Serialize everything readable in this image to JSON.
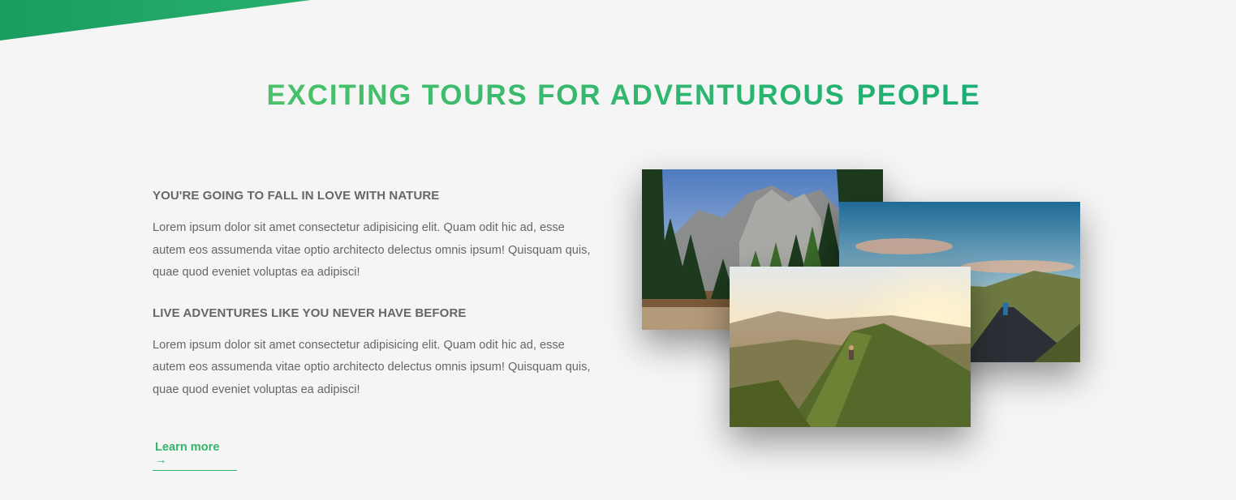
{
  "section": {
    "title_part1": "EXCITING TOURS FOR ADVENTUROUS",
    "title_part2": "PEOPLE"
  },
  "features": [
    {
      "heading": "YOU'RE GOING TO FALL IN LOVE WITH NATURE",
      "text": "Lorem ipsum dolor sit amet consectetur adipisicing elit. Quam odit hic ad, esse autem eos assumenda vitae optio architecto delectus omnis ipsum! Quisquam quis, quae quod eveniet voluptas ea adipisci!"
    },
    {
      "heading": "LIVE ADVENTURES LIKE YOU NEVER HAVE BEFORE",
      "text": "Lorem ipsum dolor sit amet consectetur adipisicing elit. Quam odit hic ad, esse autem eos assumenda vitae optio architecto delectus omnis ipsum! Quisquam quis, quae quod eveniet voluptas ea adipisci!"
    }
  ],
  "cta": {
    "label": "Learn more →"
  },
  "colors": {
    "accent_green": "#35b56b",
    "title_gradient_start": "#5cc866",
    "title_gradient_end": "#0aa775",
    "background": "#f5f5f5"
  },
  "photos": [
    {
      "icon": "forest-mountain-photo"
    },
    {
      "icon": "cyclist-road-photo"
    },
    {
      "icon": "mountain-ridge-hiker-photo"
    }
  ]
}
